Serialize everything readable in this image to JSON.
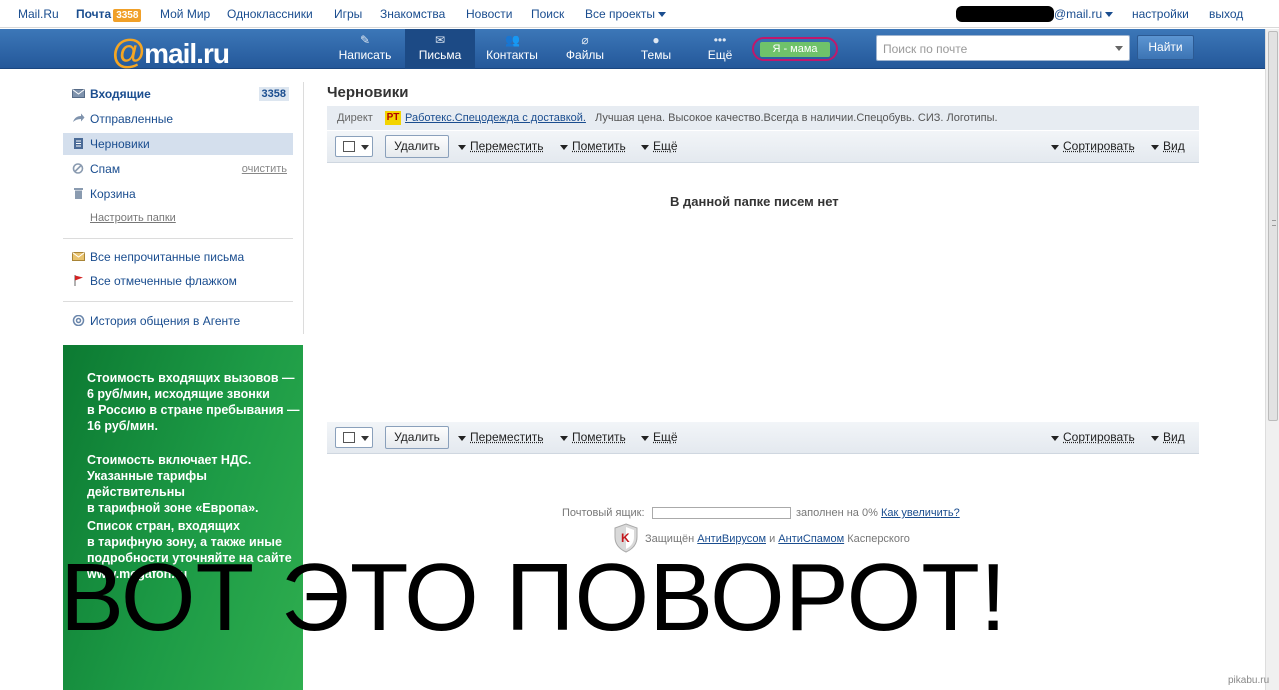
{
  "portal": {
    "links": [
      {
        "label": "Mail.Ru"
      },
      {
        "label": "Почта",
        "badge": "3358"
      },
      {
        "label": "Мой Мир"
      },
      {
        "label": "Одноклассники"
      },
      {
        "label": "Игры"
      },
      {
        "label": "Знакомства"
      },
      {
        "label": "Новости"
      },
      {
        "label": "Поиск"
      },
      {
        "label": "Все проекты"
      }
    ],
    "account_domain": "@mail.ru",
    "settings": "настройки",
    "logout": "выход"
  },
  "header": {
    "logo_at": "@",
    "logo_text": "mail.ru",
    "buttons": [
      {
        "label": "Написать",
        "icon": "pencil-icon"
      },
      {
        "label": "Письма",
        "icon": "envelope-icon"
      },
      {
        "label": "Контакты",
        "icon": "contacts-icon"
      },
      {
        "label": "Файлы",
        "icon": "paperclip-icon"
      },
      {
        "label": "Темы",
        "icon": "palette-icon"
      },
      {
        "label": "Ещё",
        "icon": "more-dots-icon"
      }
    ],
    "mom_button": "Я - мама",
    "search_placeholder": "Поиск по почте",
    "find_button": "Найти"
  },
  "sidebar": {
    "folders": [
      {
        "label": "Входящие",
        "count": "3358",
        "icon": "inbox-icon"
      },
      {
        "label": "Отправленные",
        "icon": "sent-icon"
      },
      {
        "label": "Черновики",
        "icon": "drafts-icon"
      },
      {
        "label": "Спам",
        "action": "очистить",
        "icon": "spam-icon"
      },
      {
        "label": "Корзина",
        "icon": "trash-icon"
      }
    ],
    "configure": "Настроить папки",
    "unread": "Все непрочитанные письма",
    "flagged": "Все отмеченные флажком",
    "agent": "История общения в Агенте"
  },
  "ad": {
    "p1": [
      "Стоимость входящих вызовов —",
      "6 руб/мин, исходящие звонки",
      "в Россию в стране пребывания —",
      "16 руб/мин."
    ],
    "p2": [
      "Стоимость включает НДС.",
      "Указанные тарифы действительны",
      "в тарифной зоне «Европа»."
    ],
    "p3": [
      "Список стран, входящих",
      "в тарифную зону, а также иные",
      "подробности уточняйте на сайте",
      "www.megafon.ru"
    ]
  },
  "main": {
    "title": "Черновики",
    "direct_label": "Директ",
    "direct_badge": "РТ",
    "direct_link": "Работекс.Спецодежда с доставкой.",
    "direct_text": "Лучшая цена. Высокое качество.Всегда в наличии.Спецобувь. СИЗ. Логотипы.",
    "toolbar": {
      "delete": "Удалить",
      "move": "Переместить",
      "mark": "Пометить",
      "more": "Ещё",
      "sort": "Сортировать",
      "view": "Вид"
    },
    "empty": "В данной папке писем нет"
  },
  "footer": {
    "quota_label": "Почтовый ящик:",
    "quota_fill": 0,
    "quota_text": "заполнен на 0%",
    "quota_link": "Как увеличить?",
    "protected": "Защищён",
    "antivirus": "АнтиВирусом",
    "and": "и",
    "antispam": "АнтиСпамом",
    "vendor": "Касперского"
  },
  "caption": "ВОТ ЭТО ПОВОРОТ!",
  "watermark": "pikabu.ru",
  "colors": {
    "header_blue": "#2f68a8",
    "accent_orange": "#f5a623",
    "mom_green": "#6fc26a",
    "mom_ring": "#c0186c",
    "ad_green": "#1d9b46"
  }
}
